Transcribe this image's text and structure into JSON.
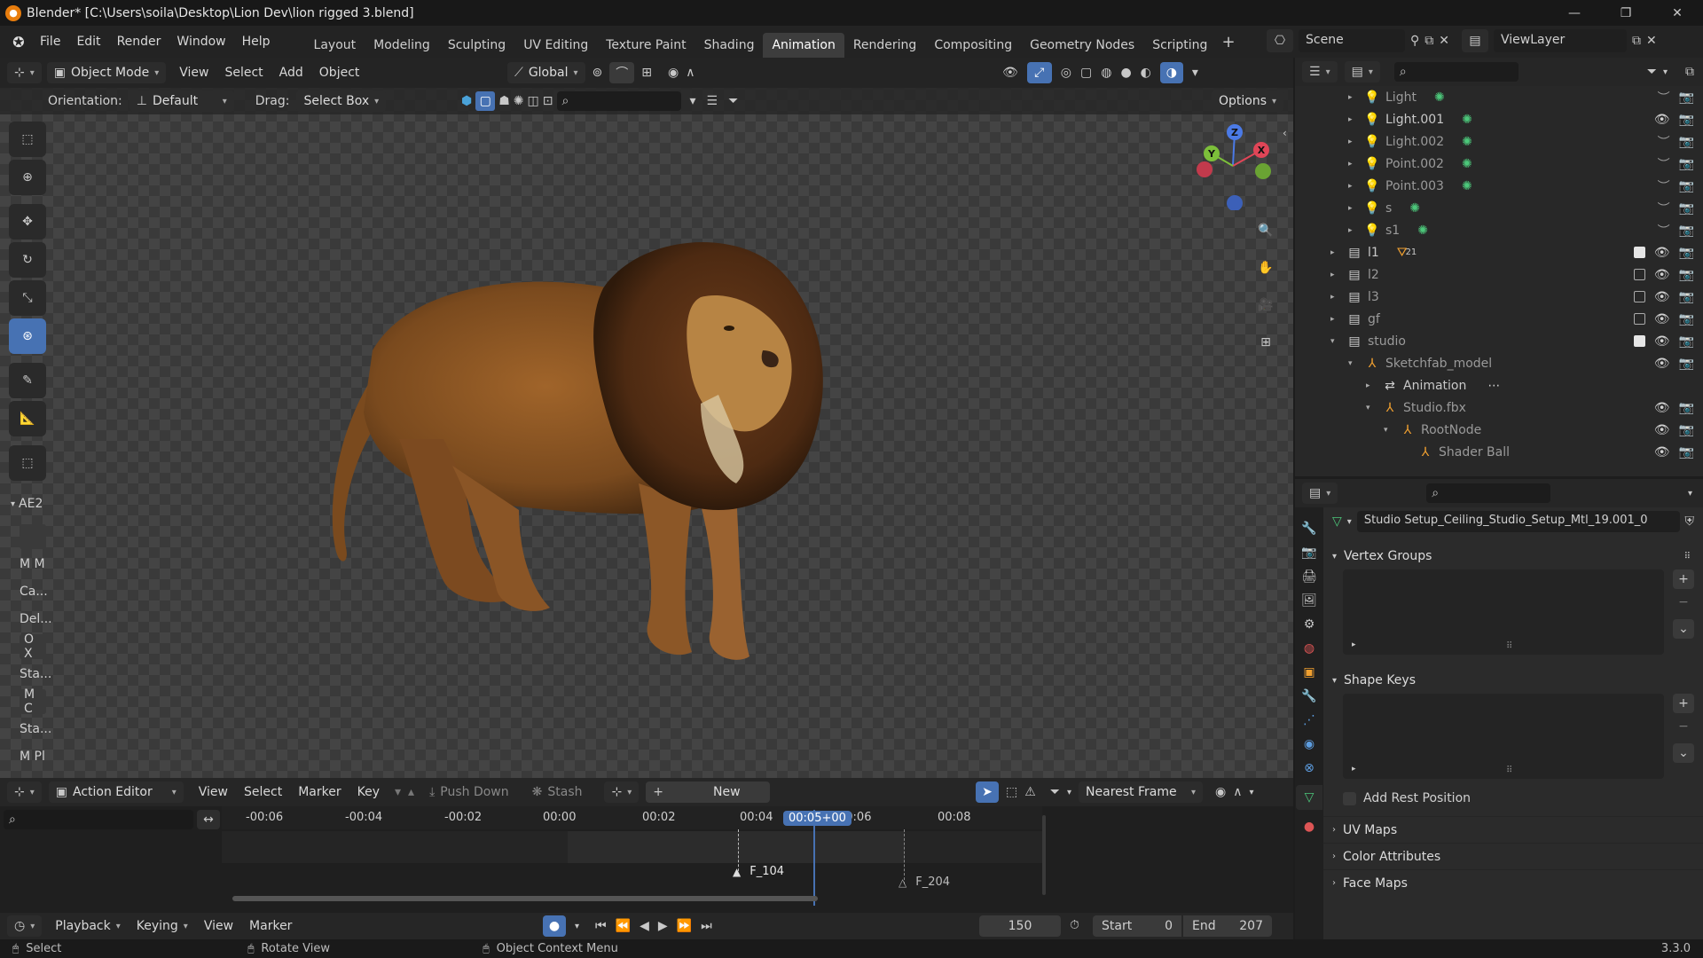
{
  "titlebar": {
    "title": "Blender* [C:\\Users\\soila\\Desktop\\Lion Dev\\lion rigged 3.blend]"
  },
  "menu": [
    "File",
    "Edit",
    "Render",
    "Window",
    "Help"
  ],
  "workspaces": [
    "Layout",
    "Modeling",
    "Sculpting",
    "UV Editing",
    "Texture Paint",
    "Shading",
    "Animation",
    "Rendering",
    "Compositing",
    "Geometry Nodes",
    "Scripting"
  ],
  "active_workspace": "Animation",
  "scene": {
    "name": "Scene",
    "view_layer": "ViewLayer"
  },
  "viewport": {
    "mode": "Object Mode",
    "menus": [
      "View",
      "Select",
      "Add",
      "Object"
    ],
    "transform_orientation": "Global",
    "orientation_label": "Orientation:",
    "orientation_value": "Default",
    "drag_label": "Drag:",
    "drag_value": "Select Box",
    "options_label": "Options"
  },
  "sidepanel": {
    "header": "AE2",
    "items": [
      "M M",
      "Ca...",
      "Del...",
      "O X",
      "Sta...",
      "M C",
      "Sta...",
      "M Pl"
    ]
  },
  "action_editor": {
    "mode": "Action Editor",
    "menus": [
      "View",
      "Select",
      "Marker",
      "Key"
    ],
    "push_down": "Push Down",
    "stash": "Stash",
    "new": "New",
    "snap": "Nearest Frame",
    "ticks": [
      "-00:06",
      "-00:04",
      "-00:02",
      "00:00",
      "00:02",
      "00:04",
      "00:06",
      "00:08"
    ],
    "current_time": "00:05+00",
    "markers": [
      {
        "label": "F_104"
      },
      {
        "label": "F_204"
      }
    ]
  },
  "playback": {
    "menus": [
      "Playback",
      "Keying",
      "View",
      "Marker"
    ],
    "current_frame": "150",
    "start_label": "Start",
    "start": "0",
    "end_label": "End",
    "end": "207"
  },
  "statusbar": {
    "select": "Select",
    "rotate": "Rotate View",
    "context": "Object Context Menu",
    "version": "3.3.0"
  },
  "outliner": {
    "rows": [
      {
        "name": "Light",
        "indent": 2,
        "kind": "light",
        "dim": true
      },
      {
        "name": "Light.001",
        "indent": 2,
        "kind": "light",
        "dim": false
      },
      {
        "name": "Light.002",
        "indent": 2,
        "kind": "light",
        "dim": true
      },
      {
        "name": "Point.002",
        "indent": 2,
        "kind": "light",
        "dim": true
      },
      {
        "name": "Point.003",
        "indent": 2,
        "kind": "light",
        "dim": true
      },
      {
        "name": "s",
        "indent": 2,
        "kind": "light",
        "dim": true
      },
      {
        "name": "s1",
        "indent": 2,
        "kind": "light",
        "dim": true
      },
      {
        "name": "l1",
        "indent": 1,
        "kind": "collection",
        "dim": false,
        "badge": "21"
      },
      {
        "name": "l2",
        "indent": 1,
        "kind": "collection",
        "dim": true
      },
      {
        "name": "l3",
        "indent": 1,
        "kind": "collection",
        "dim": true
      },
      {
        "name": "gf",
        "indent": 1,
        "kind": "collection",
        "dim": true
      },
      {
        "name": "studio",
        "indent": 1,
        "kind": "collection",
        "dim": true
      },
      {
        "name": "Sketchfab_model",
        "indent": 2,
        "kind": "empty",
        "dim": true
      },
      {
        "name": "Animation",
        "indent": 3,
        "kind": "action",
        "dim": false
      },
      {
        "name": "Studio.fbx",
        "indent": 3,
        "kind": "empty",
        "dim": true
      },
      {
        "name": "RootNode",
        "indent": 4,
        "kind": "empty",
        "dim": true
      },
      {
        "name": "Shader Ball",
        "indent": 5,
        "kind": "empty",
        "dim": true
      }
    ]
  },
  "properties": {
    "data_name": "Studio Setup_Ceiling_Studio_Setup_Mtl_19.001_0",
    "panels": [
      "Vertex Groups",
      "Shape Keys",
      "UV Maps",
      "Color Attributes",
      "Face Maps"
    ],
    "add_rest_position": "Add Rest Position"
  },
  "colors": {
    "accent": "#4772b3",
    "selected_frame": "#4772b3"
  }
}
